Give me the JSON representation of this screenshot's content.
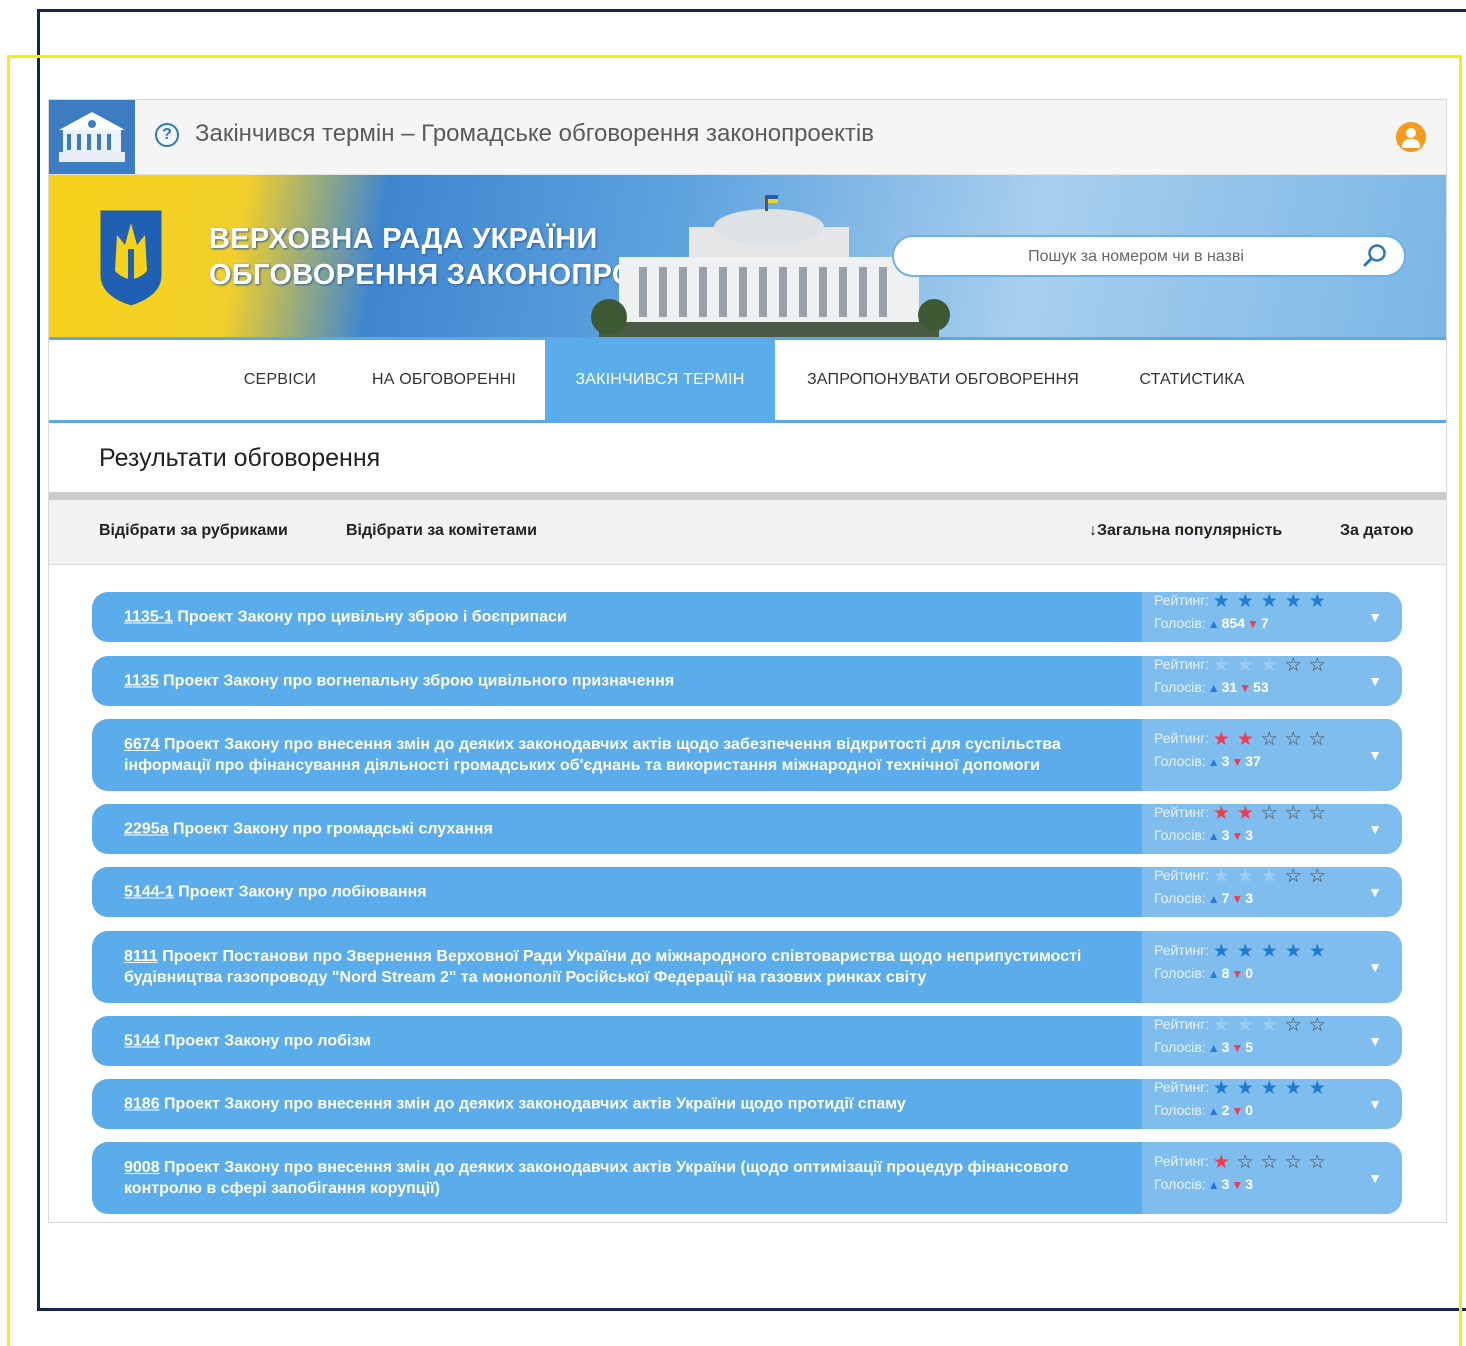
{
  "titlebar": {
    "title": "Закінчився термін – Громадське обговорення законопроектів"
  },
  "banner": {
    "line1": "ВЕРХОВНА РАДА УКРАЇНИ",
    "line2": "ОБГОВОРЕННЯ ЗАКОНОПРОЕКТІВ",
    "search_placeholder": "Пошук за номером чи в назві"
  },
  "nav": {
    "items": [
      "СЕРВІСИ",
      "НА ОБГОВОРЕННІ",
      "ЗАКІНЧИВСЯ ТЕРМІН",
      "ЗАПРОПОНУВАТИ ОБГОВОРЕННЯ",
      "СТАТИСТИКА"
    ],
    "active": "ЗАКІНЧИВСЯ ТЕРМІН"
  },
  "heading": "Результати обговорення",
  "filters": {
    "by_category": "Відібрати за рубриками",
    "by_committee": "Відібрати за комітетами",
    "sort_popularity": "↓Загальна популярність",
    "sort_date": "За датою"
  },
  "labels": {
    "rating": "Рейтинг:",
    "votes": "Голосів:"
  },
  "colors": {
    "row_bg": "#5aacea",
    "accent": "#2a76c5"
  },
  "bills": [
    {
      "number": "1135-1",
      "title": "Проект Закону про цивільну зброю і боєприпаси",
      "stars": "full,full,full,full,full",
      "up": "854",
      "down": "7"
    },
    {
      "number": "1135",
      "title": "Проект Закону про вогнепальну зброю цивільного призначення",
      "stars": "faint,faint,faint,empty,empty",
      "up": "31",
      "down": "53"
    },
    {
      "number": "6674",
      "title": "Проект Закону про внесення змін до деяких законодавчих актів щодо забезпечення відкритості для суспільства інформації про фінансування діяльності громадських об'єднань та використання міжнародної технічної допомоги",
      "stars": "red,red,empty,empty,empty",
      "up": "3",
      "down": "37"
    },
    {
      "number": "2295а",
      "title": "Проект Закону про громадські слухання",
      "stars": "red,red,empty,empty,empty",
      "up": "3",
      "down": "3"
    },
    {
      "number": "5144-1",
      "title": "Проект Закону про лобіювання",
      "stars": "faint,faint,faint,empty,empty",
      "up": "7",
      "down": "3"
    },
    {
      "number": "8111",
      "title": "Проект Постанови про Звернення Верховної Ради України до міжнародного співтовариства щодо неприпустимості будівництва газопроводу \"Nord Stream 2\" та монополії Російської Федерації на газових ринках світу",
      "stars": "full,full,full,full,full",
      "up": "8",
      "down": "0"
    },
    {
      "number": "5144",
      "title": "Проект Закону про лобізм",
      "stars": "faint,faint,faint,empty,empty",
      "up": "3",
      "down": "5"
    },
    {
      "number": "8186",
      "title": "Проект Закону про внесення змін до деяких законодавчих актів України щодо протидії спаму",
      "stars": "full,full,full,full,full",
      "up": "2",
      "down": "0"
    },
    {
      "number": "9008",
      "title": "Проект Закону про внесення змін до деяких законодавчих актів України (щодо оптимізації процедур фінансового контролю в сфері запобігання корупції)",
      "stars": "red,empty,empty,empty,empty",
      "up": "3",
      "down": "3"
    }
  ]
}
